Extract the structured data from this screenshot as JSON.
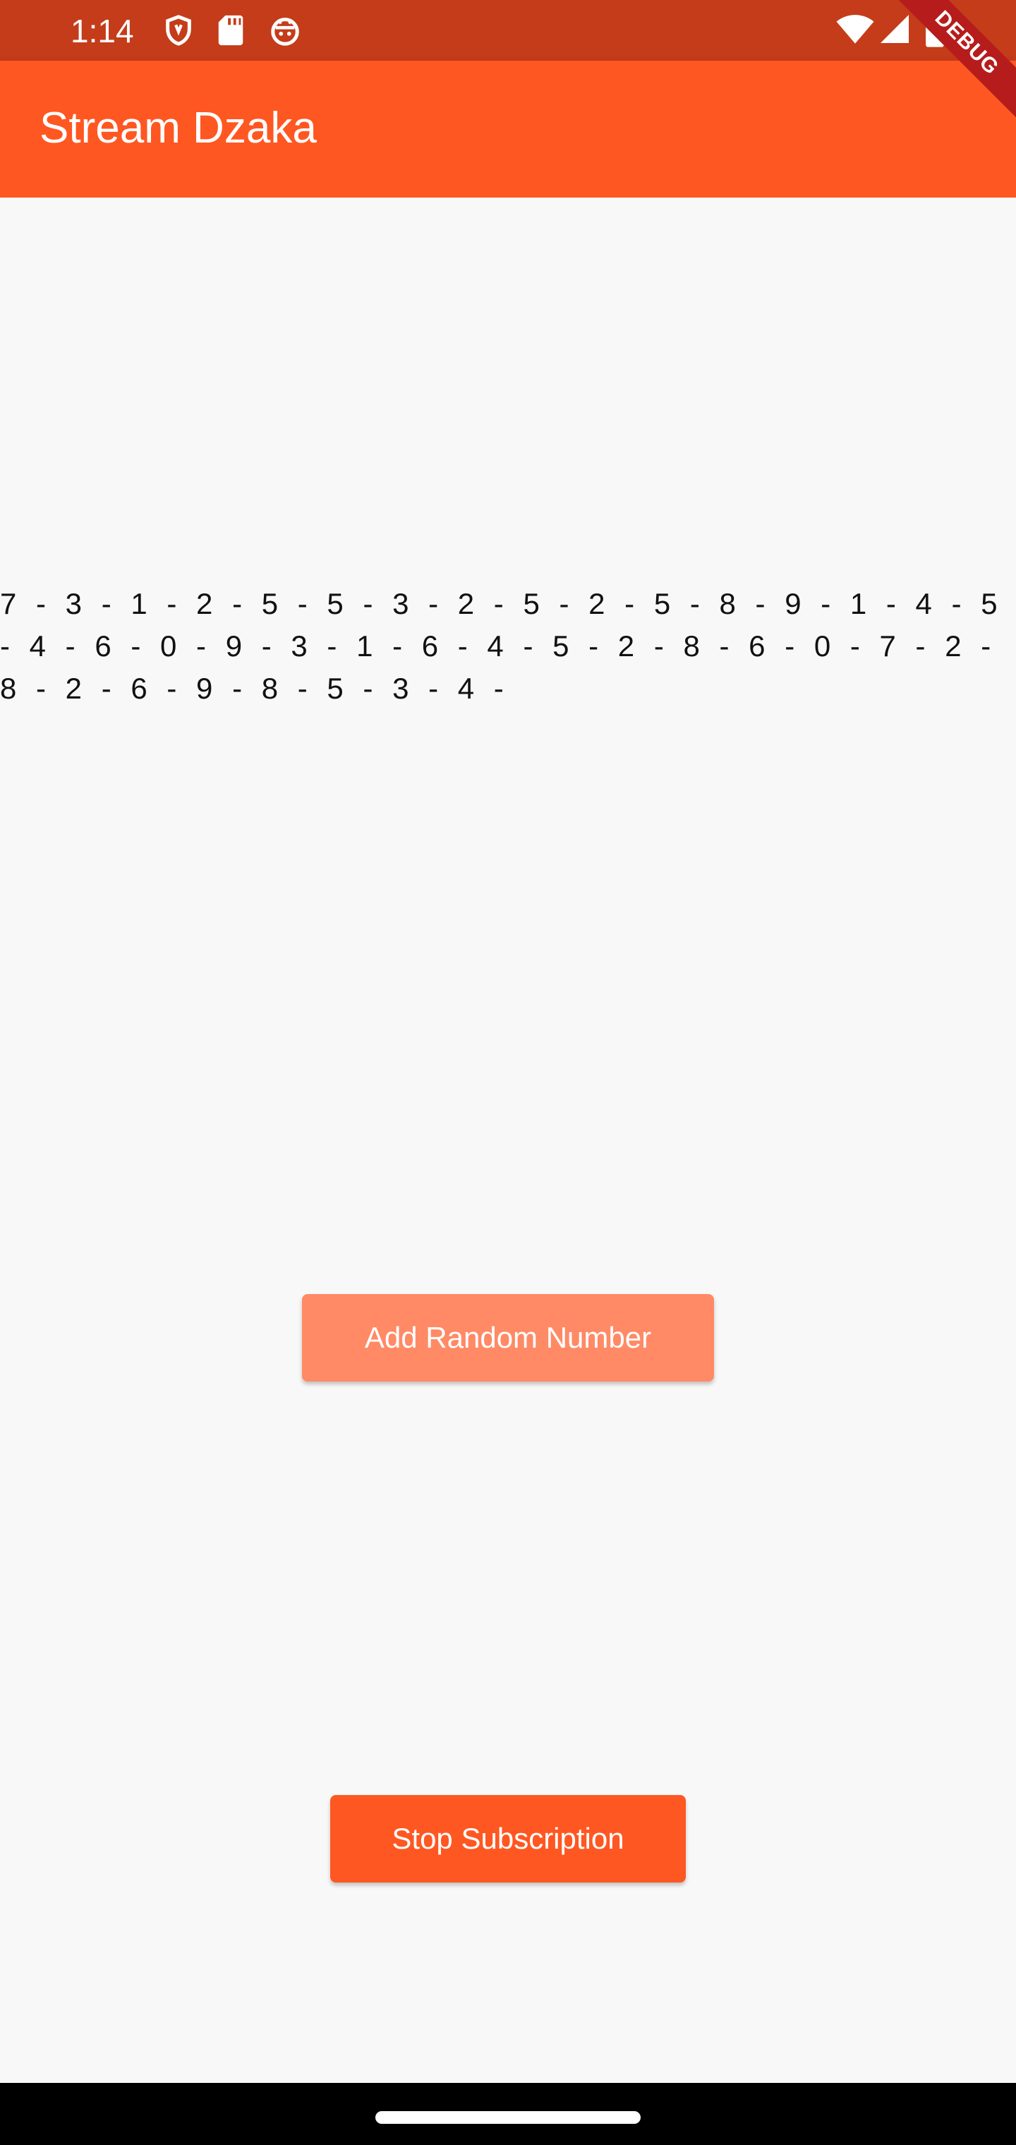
{
  "status_bar": {
    "time": "1:14",
    "icons": [
      "shield-icon",
      "sd-card-icon",
      "android-face-icon",
      "wifi-icon",
      "signal-icon",
      "battery-icon"
    ]
  },
  "app_bar": {
    "title": "Stream Dzaka",
    "debug_label": "DEBUG"
  },
  "stream": {
    "text": "7 - 3 - 1 - 2 - 5 - 5 - 3 - 2 - 5 - 2 - 5 - 8 - 9 - 1 - 4 - 5 - 4 - 6 - 0 - 9 - 3 - 1 - 6 - 4 - 5 - 2 - 8 - 6 - 0 - 7 - 2 - 8 - 2 - 6 - 9 - 8 - 5 - 3 - 4 -"
  },
  "buttons": {
    "add_label": "Add Random Number",
    "stop_label": "Stop Subscription"
  },
  "colors": {
    "primary": "#ff5722",
    "status_bar": "#c43c19",
    "button_disabled": "#ff8a65",
    "background": "#f8f8f8"
  }
}
